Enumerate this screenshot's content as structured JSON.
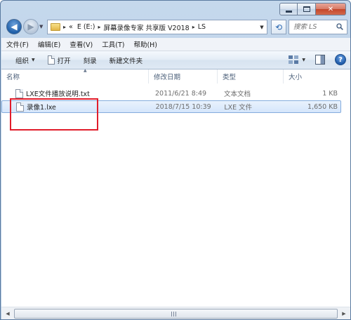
{
  "window": {
    "minimize_icon": "minimize-icon",
    "maximize_icon": "maximize-icon",
    "close_label": "✕"
  },
  "nav": {
    "back_glyph": "◀",
    "forward_glyph": "▶"
  },
  "address": {
    "overflow": "«",
    "crumbs": [
      "E (E:)",
      "屏幕录像专家 共享版 V2018",
      "LS"
    ],
    "sep": "▸"
  },
  "search": {
    "placeholder": "搜索 LS"
  },
  "menu": [
    "文件(F)",
    "编辑(E)",
    "查看(V)",
    "工具(T)",
    "帮助(H)"
  ],
  "toolbar": {
    "organize": "组织",
    "open": "打开",
    "burn": "刻录",
    "new_folder": "新建文件夹",
    "help_glyph": "?"
  },
  "columns": {
    "name": "名称",
    "date": "修改日期",
    "type": "类型",
    "size": "大小"
  },
  "files": [
    {
      "name": "LXE文件播放说明.txt",
      "date": "2011/6/21 8:49",
      "type": "文本文档",
      "size": "1 KB",
      "selected": false
    },
    {
      "name": "录像1.lxe",
      "date": "2018/7/15 10:39",
      "type": "LXE 文件",
      "size": "1,650 KB",
      "selected": true
    }
  ],
  "colors": {
    "selection_border": "#84acdd",
    "highlight_box": "#e11d2b"
  }
}
